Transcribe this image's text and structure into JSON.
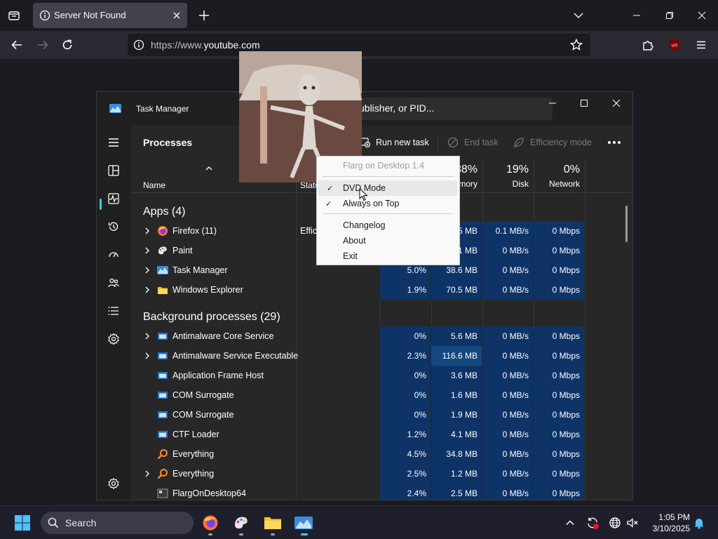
{
  "browser": {
    "tab_title": "Server Not Found",
    "url_prefix": "https://www.",
    "url_domain": "youtube.com"
  },
  "task_manager": {
    "title": "Task Manager",
    "search_placeholder": "ublisher, or PID...",
    "heading": "Processes",
    "commands": {
      "run_new_task": "Run new task",
      "end_task": "End task",
      "efficiency_mode": "Efficiency mode"
    },
    "columns": {
      "name": "Name",
      "status": "Statu",
      "cpu_pct": "",
      "memory_pct": "38%",
      "memory": "mory",
      "disk_pct": "19%",
      "disk": "Disk",
      "network_pct": "0%",
      "network": "Network"
    },
    "apps_header": "Apps (4)",
    "apps": [
      {
        "name": "Firefox (11)",
        "status": "Effic",
        "cpu": "",
        "memory": "5 MB",
        "disk": "0.1 MB/s",
        "network": "0 Mbps"
      },
      {
        "name": "Paint",
        "status": "",
        "cpu": "",
        "memory": "1 MB",
        "disk": "0 MB/s",
        "network": "0 Mbps"
      },
      {
        "name": "Task Manager",
        "status": "",
        "cpu": "5.0%",
        "memory": "38.6 MB",
        "disk": "0 MB/s",
        "network": "0 Mbps"
      },
      {
        "name": "Windows Explorer",
        "status": "",
        "cpu": "1.9%",
        "memory": "70.5 MB",
        "disk": "0 MB/s",
        "network": "0 Mbps"
      }
    ],
    "bg_header": "Background processes (29)",
    "background": [
      {
        "name": "Antimalware Core Service",
        "cpu": "0%",
        "memory": "5.6 MB",
        "disk": "0 MB/s",
        "network": "0 Mbps"
      },
      {
        "name": "Antimalware Service Executable",
        "cpu": "2.3%",
        "memory": "116.6 MB",
        "disk": "0 MB/s",
        "network": "0 Mbps"
      },
      {
        "name": "Application Frame Host",
        "cpu": "0%",
        "memory": "3.6 MB",
        "disk": "0 MB/s",
        "network": "0 Mbps"
      },
      {
        "name": "COM Surrogate",
        "cpu": "0%",
        "memory": "1.6 MB",
        "disk": "0 MB/s",
        "network": "0 Mbps"
      },
      {
        "name": "COM Surrogate",
        "cpu": "0%",
        "memory": "1.9 MB",
        "disk": "0 MB/s",
        "network": "0 Mbps"
      },
      {
        "name": "CTF Loader",
        "cpu": "1.2%",
        "memory": "4.1 MB",
        "disk": "0 MB/s",
        "network": "0 Mbps"
      },
      {
        "name": "Everything",
        "cpu": "4.5%",
        "memory": "34.8 MB",
        "disk": "0 MB/s",
        "network": "0 Mbps"
      },
      {
        "name": "Everything",
        "cpu": "2.5%",
        "memory": "1.2 MB",
        "disk": "0 MB/s",
        "network": "0 Mbps"
      },
      {
        "name": "FlargOnDesktop64",
        "cpu": "2.4%",
        "memory": "2.5 MB",
        "disk": "0 MB/s",
        "network": "0 Mbps"
      }
    ]
  },
  "context_menu": {
    "header": "Flarg on Desktop 1.4",
    "dvd_mode": "DVD Mode",
    "always_on_top": "Always on Top",
    "changelog": "Changelog",
    "about": "About",
    "exit": "Exit"
  },
  "taskbar": {
    "search_label": "Search",
    "time": "1:05 PM",
    "date": "3/10/2025"
  },
  "colors": {
    "accent": "#4cc2ff",
    "heat_cell": "#0f3a6e",
    "heat_cell_light": "#123a66"
  }
}
